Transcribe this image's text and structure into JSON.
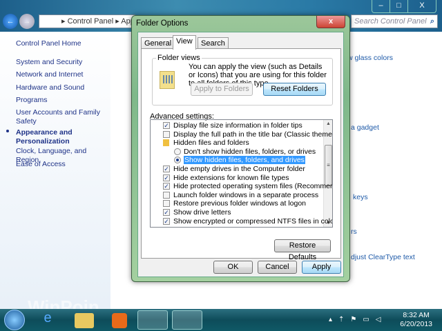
{
  "explorer": {
    "breadcrumb": [
      "Control Panel",
      "Appearance and Personalization"
    ],
    "search_placeholder": "Search Control Panel",
    "window_controls": {
      "minimize": "–",
      "maximize": "□",
      "close": "X"
    },
    "nav": [
      "Control Panel Home",
      "System and Security",
      "Network and Internet",
      "Hardware and Sound",
      "Programs",
      "User Accounts and Family Safety",
      "Appearance and Personalization",
      "Clock, Language, and Region",
      "Ease of Access"
    ],
    "current_nav": "Appearance and Personalization",
    "background_links": [
      "w glass colors",
      "a gadget",
      "keys",
      "rs",
      "djust ClearType text"
    ]
  },
  "dialog": {
    "title": "Folder Options",
    "close": "x",
    "tabs": [
      "General",
      "View",
      "Search"
    ],
    "active_tab": "View",
    "folder_views": {
      "label": "Folder views",
      "text": "You can apply the view (such as Details or Icons) that you are using for this folder to all folders of this type.",
      "apply_button": "Apply to Folders",
      "reset_button": "Reset Folders"
    },
    "advanced_label": "Advanced settings:",
    "items": [
      {
        "type": "checkbox",
        "checked": true,
        "label": "Display file size information in folder tips"
      },
      {
        "type": "checkbox",
        "checked": false,
        "label": "Display the full path in the title bar (Classic theme only)"
      },
      {
        "type": "folder",
        "label": "Hidden files and folders"
      },
      {
        "type": "radio",
        "checked": false,
        "label": "Don't show hidden files, folders, or drives"
      },
      {
        "type": "radio",
        "checked": true,
        "selected": true,
        "label": "Show hidden files, folders, and drives"
      },
      {
        "type": "checkbox",
        "checked": true,
        "label": "Hide empty drives in the Computer folder"
      },
      {
        "type": "checkbox",
        "checked": true,
        "label": "Hide extensions for known file types"
      },
      {
        "type": "checkbox",
        "checked": true,
        "label": "Hide protected operating system files (Recommended)"
      },
      {
        "type": "checkbox",
        "checked": false,
        "label": "Launch folder windows in a separate process"
      },
      {
        "type": "checkbox",
        "checked": false,
        "label": "Restore previous folder windows at logon"
      },
      {
        "type": "checkbox",
        "checked": true,
        "label": "Show drive letters"
      },
      {
        "type": "checkbox",
        "checked": true,
        "label": "Show encrypted or compressed NTFS files in color"
      }
    ],
    "restore_button": "Restore Defaults",
    "ok": "OK",
    "cancel": "Cancel",
    "apply": "Apply"
  },
  "taskbar": {
    "time": "8:32 AM",
    "date": "6/20/2013",
    "watermark": "WinPoin"
  }
}
